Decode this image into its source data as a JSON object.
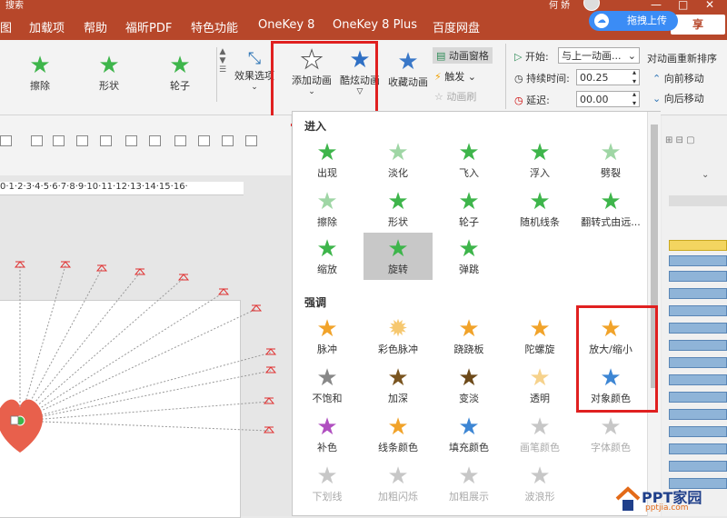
{
  "titlebar": {
    "search": "搜索",
    "user": "何 娇",
    "min": "—",
    "max": "□",
    "close": "✕"
  },
  "tabs": [
    "图",
    "加载项",
    "帮助",
    "福昕PDF",
    "特色功能",
    "OneKey 8",
    "OneKey 8 Plus",
    "百度网盘"
  ],
  "share": "享",
  "baidu": {
    "label": "拖拽上传"
  },
  "ribbon": {
    "gallery_items": [
      "擦除",
      "形状",
      "轮子"
    ],
    "effect_options": "效果选项",
    "add_animation": "添加动画",
    "cool_animation": "酷炫动画",
    "collect_animation": "收藏动画",
    "animation_pane": "动画窗格",
    "trigger": "触发",
    "animation_painter": "动画刷",
    "start_label": "开始:",
    "start_value": "与上一动画...",
    "duration_label": "持续时间:",
    "duration_value": "00.25",
    "delay_label": "延迟:",
    "delay_value": "00.00",
    "reorder_label": "对动画重新排序",
    "move_earlier": "向前移动",
    "move_later": "向后移动"
  },
  "ruler": "0·1·2·3·4·5·6·7·8·9·10·11·12·13·14·15·16·",
  "gallery": {
    "section_entrance": "进入",
    "entrance": [
      {
        "label": "出现",
        "state": "normal"
      },
      {
        "label": "淡化",
        "state": "normal"
      },
      {
        "label": "飞入",
        "state": "normal"
      },
      {
        "label": "浮入",
        "state": "normal"
      },
      {
        "label": "劈裂",
        "state": "normal"
      },
      {
        "label": "擦除",
        "state": "normal"
      },
      {
        "label": "形状",
        "state": "normal"
      },
      {
        "label": "轮子",
        "state": "normal"
      },
      {
        "label": "随机线条",
        "state": "normal"
      },
      {
        "label": "翻转式由远...",
        "state": "normal"
      },
      {
        "label": "缩放",
        "state": "normal"
      },
      {
        "label": "旋转",
        "state": "selected"
      },
      {
        "label": "弹跳",
        "state": "normal"
      }
    ],
    "section_emphasis": "强调",
    "emphasis": [
      {
        "label": "脉冲",
        "state": "normal"
      },
      {
        "label": "彩色脉冲",
        "state": "normal"
      },
      {
        "label": "跷跷板",
        "state": "normal"
      },
      {
        "label": "陀螺旋",
        "state": "normal"
      },
      {
        "label": "放大/缩小",
        "state": "normal"
      },
      {
        "label": "不饱和",
        "state": "normal"
      },
      {
        "label": "加深",
        "state": "normal"
      },
      {
        "label": "变淡",
        "state": "normal"
      },
      {
        "label": "透明",
        "state": "normal"
      },
      {
        "label": "对象颜色",
        "state": "normal"
      },
      {
        "label": "补色",
        "state": "normal"
      },
      {
        "label": "线条颜色",
        "state": "normal"
      },
      {
        "label": "填充颜色",
        "state": "normal"
      },
      {
        "label": "画笔颜色",
        "state": "disabled"
      },
      {
        "label": "字体颜色",
        "state": "disabled"
      },
      {
        "label": "下划线",
        "state": "disabled"
      },
      {
        "label": "加粗闪烁",
        "state": "disabled"
      },
      {
        "label": "加粗展示",
        "state": "disabled"
      },
      {
        "label": "波浪形",
        "state": "disabled"
      }
    ]
  },
  "watermark": {
    "text": "PPT家园",
    "url": "pptjia.com"
  }
}
